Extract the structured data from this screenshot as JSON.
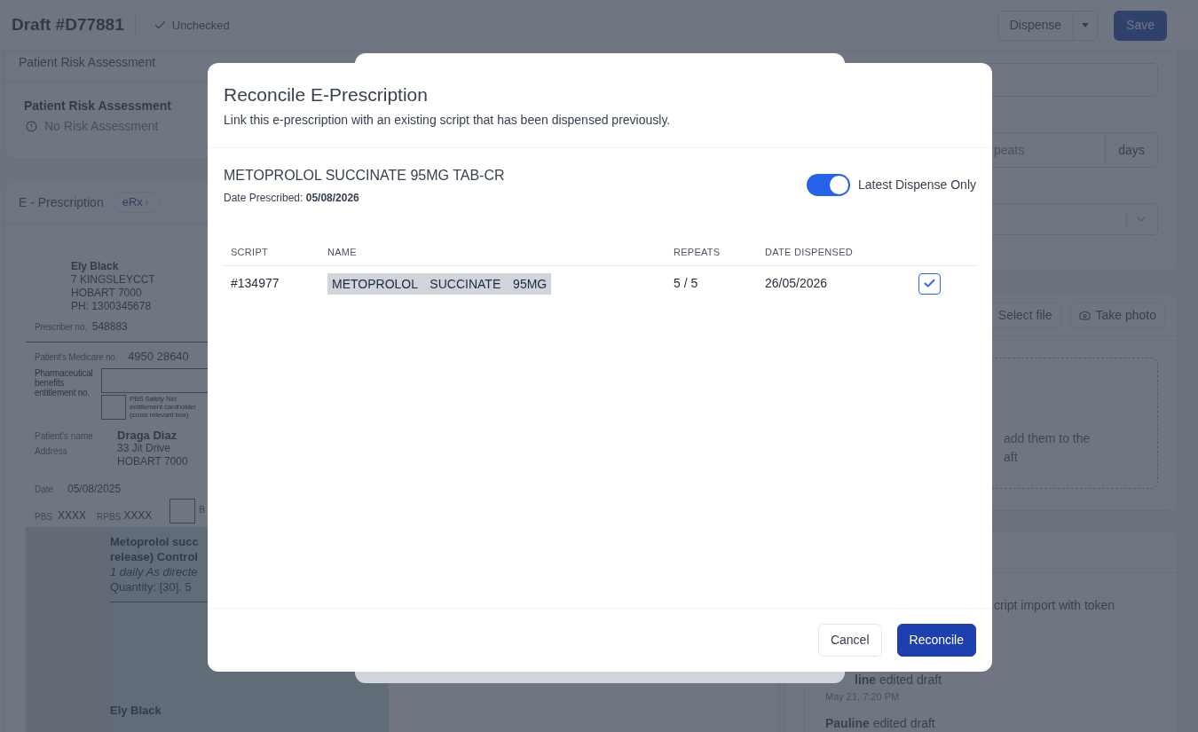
{
  "header": {
    "title": "Draft #D77881",
    "status": "Unchecked",
    "actions": [
      {
        "kind": "split",
        "label": "Dispense"
      },
      {
        "kind": "primary",
        "label": "Save"
      }
    ]
  },
  "risk_card": {
    "title": "Patient Risk Assessment",
    "heading": "Patient Risk Assessment",
    "status": "No Risk Assessment"
  },
  "eprescription": {
    "title": "E - Prescription",
    "badge": "eRx",
    "document": {
      "prescriber_name": "Ely Black",
      "prescriber_lines": [
        "7 KINGSLEYCCT",
        "HOBART 7000",
        "PH: 1300345678"
      ],
      "prescriber_no_label": "Prescriber no.",
      "prescriber_no": "548883",
      "medicare_label": "Patient's Medicare no.",
      "medicare_no": "4950 28640",
      "entitlement_label": "Pharmaceutical benefits entitlement no.",
      "safety_net_label": "PBS Safety Net entitlement cardholder (cross relevant box)",
      "patient_name_label": "Patient's name",
      "patient_name": "Draga Diaz",
      "address_label": "Address",
      "address_lines": [
        "33 Jit Drive",
        "HOBART 7000"
      ],
      "date_label": "Date",
      "date": "05/08/2025",
      "pbs_label": "PBS",
      "pbs": "XXXX",
      "rpbs_label": "RPBS",
      "rpbs": "XXXX",
      "box_label": "B",
      "medication_lines": [
        {
          "kind": "bold",
          "text": "Metoprolol succ"
        },
        {
          "kind": "bold",
          "text": "release) Control"
        },
        {
          "kind": "italic",
          "text": "1 daily As directe"
        },
        {
          "kind": "plain",
          "text": "Quantity: [30]. 5"
        }
      ],
      "signature_name": "Ely Black"
    }
  },
  "interval_field": {
    "placeholder": "peats",
    "suffix": "days"
  },
  "attachments": {
    "buttons": [
      {
        "kind": "file",
        "label": "Select file"
      },
      {
        "kind": "camera",
        "label": "Take photo"
      }
    ],
    "dropzone_lines": [
      "add them to the",
      "aft"
    ]
  },
  "activity": {
    "note": "cript import with token",
    "events": [
      {
        "text": "**line** edited draft",
        "time": "May 21, 7:20 PM"
      },
      {
        "text": "**Pauline** edited draft"
      }
    ]
  },
  "dialog": {
    "title": "Reconcile E-Prescription",
    "subtitle": "Link this e-prescription with an existing script that has been dispensed previously.",
    "drug": "METOPROLOL SUCCINATE 95MG TAB-CR",
    "date_prescribed": "Date Prescribed: **05/08/2026**",
    "toggle": {
      "label": "Latest Dispense Only",
      "on": true
    },
    "table": {
      "columns": [
        "SCRIPT",
        "NAME",
        "REPEATS",
        "DATE DISPENSED"
      ],
      "rows": [
        {
          "script": "#134977",
          "name": "METOPROLOL SUCCINATE 95MG",
          "name_highlighted": true,
          "repeats": "5 / 5",
          "date_dispensed": "26/05/2026",
          "selected": true
        }
      ]
    },
    "buttons": [
      {
        "kind": "secondary",
        "label": "Cancel"
      },
      {
        "kind": "primary",
        "label": "Reconcile"
      }
    ]
  }
}
